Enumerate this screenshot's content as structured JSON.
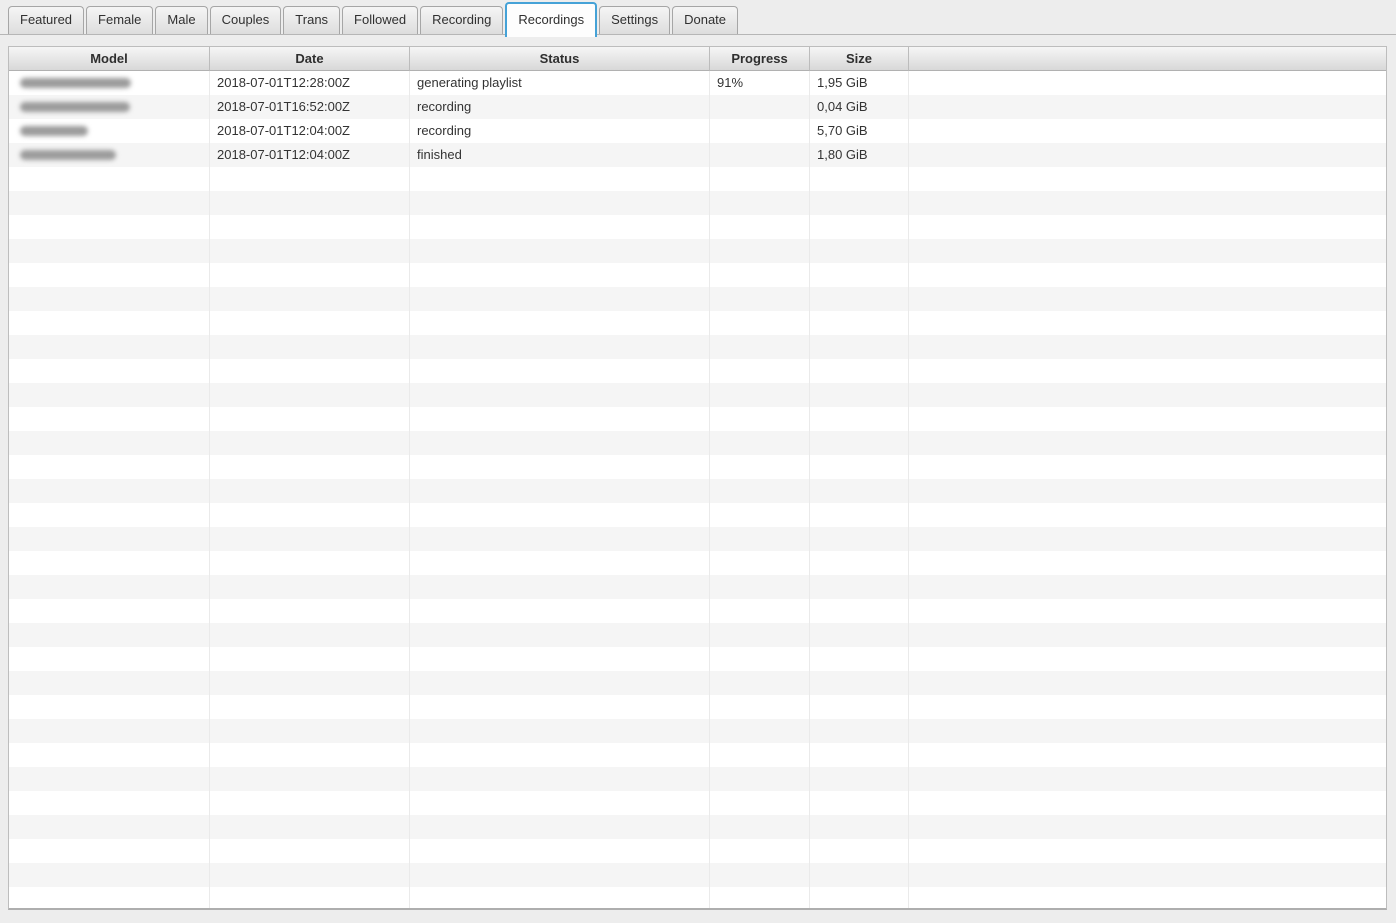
{
  "tabs": {
    "items": [
      {
        "label": "Featured",
        "active": false
      },
      {
        "label": "Female",
        "active": false
      },
      {
        "label": "Male",
        "active": false
      },
      {
        "label": "Couples",
        "active": false
      },
      {
        "label": "Trans",
        "active": false
      },
      {
        "label": "Followed",
        "active": false
      },
      {
        "label": "Recording",
        "active": false
      },
      {
        "label": "Recordings",
        "active": true
      },
      {
        "label": "Settings",
        "active": false
      },
      {
        "label": "Donate",
        "active": false
      }
    ]
  },
  "table": {
    "columns": [
      {
        "label": "Model"
      },
      {
        "label": "Date"
      },
      {
        "label": "Status"
      },
      {
        "label": "Progress"
      },
      {
        "label": "Size"
      }
    ],
    "rows": [
      {
        "model_redacted": true,
        "model_blur_width": 111,
        "date": "2018-07-01T12:28:00Z",
        "status": "generating playlist",
        "progress": "91%",
        "size": "1,95 GiB"
      },
      {
        "model_redacted": true,
        "model_blur_width": 110,
        "date": "2018-07-01T16:52:00Z",
        "status": "recording",
        "progress": "",
        "size": "0,04 GiB"
      },
      {
        "model_redacted": true,
        "model_blur_width": 68,
        "date": "2018-07-01T12:04:00Z",
        "status": "recording",
        "progress": "",
        "size": "5,70 GiB"
      },
      {
        "model_redacted": true,
        "model_blur_width": 96,
        "date": "2018-07-01T12:04:00Z",
        "status": "finished",
        "progress": "",
        "size": "1,80 GiB"
      }
    ],
    "empty_row_count": 31
  },
  "colors": {
    "accent_tab_border": "#45a2d7",
    "header_text": "#2f2f2f",
    "cell_text": "#333333",
    "row_stripe": "#f5f5f5"
  }
}
